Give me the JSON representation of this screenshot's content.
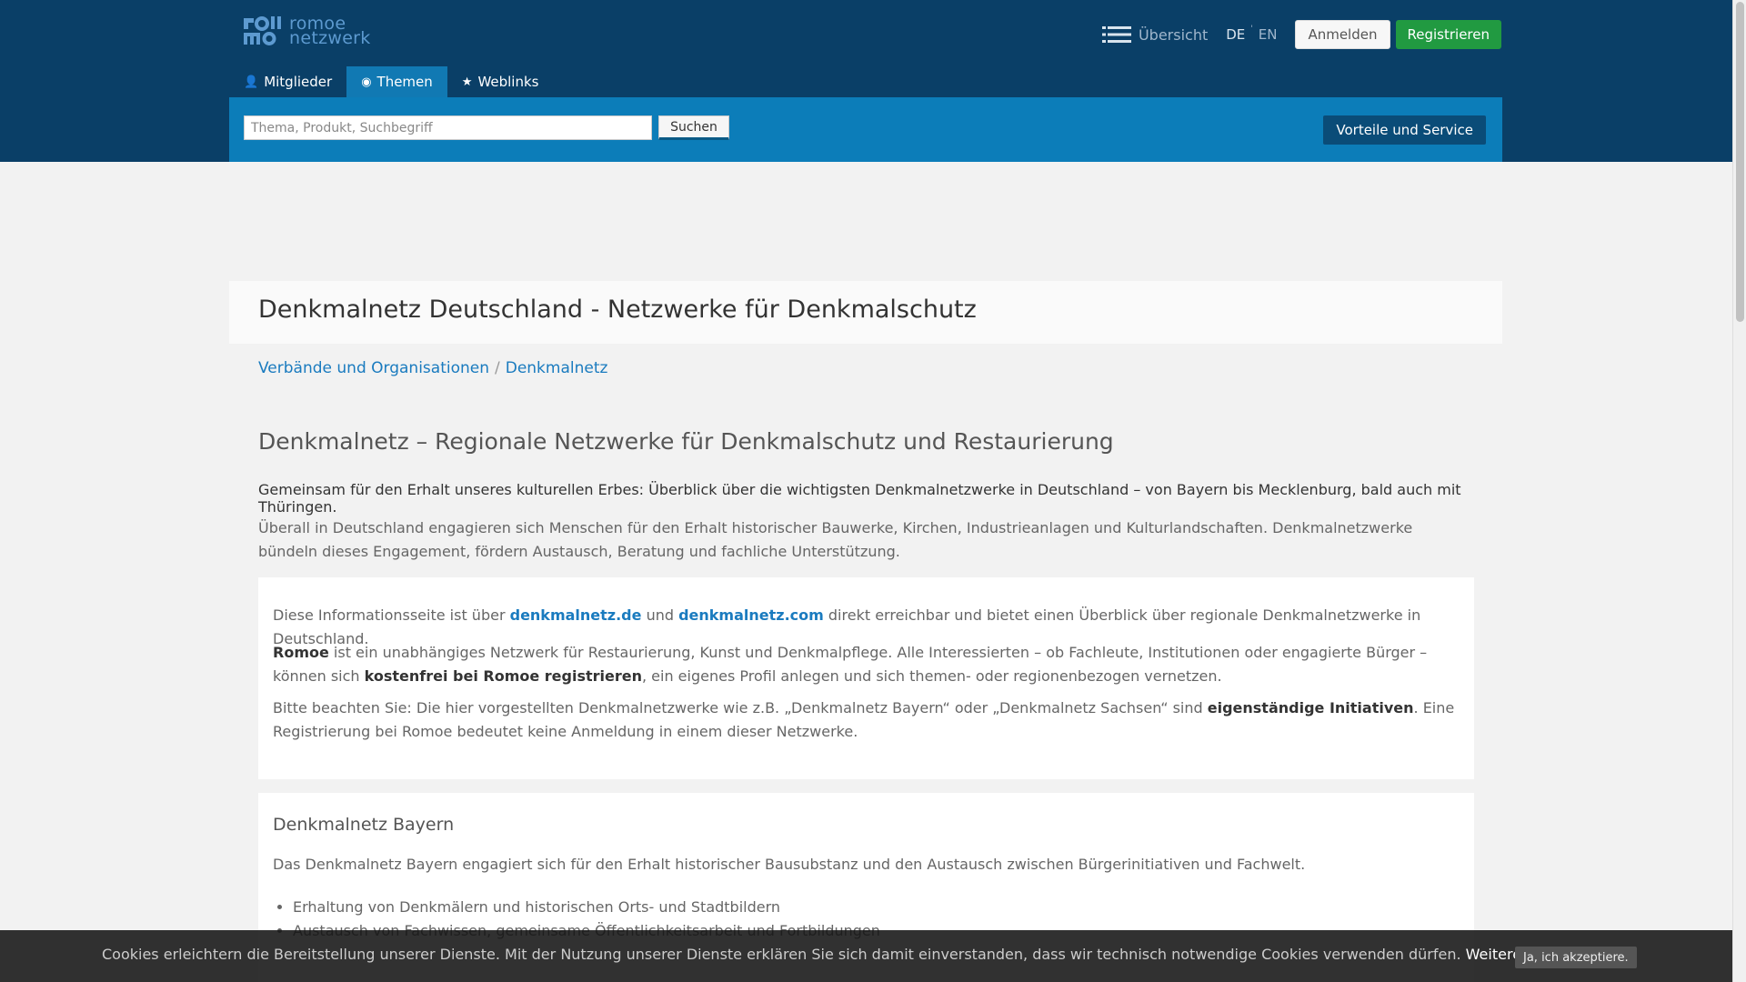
{
  "brand": {
    "logo_mark": "rom\nmo",
    "logo_text_1": "romoe",
    "logo_text_2": "netzwerk"
  },
  "header": {
    "overview_label": "Übersicht",
    "lang_de": "DE",
    "lang_sep": "'",
    "lang_en": "EN",
    "login_label": "Anmelden",
    "register_label": "Registrieren"
  },
  "tabs": [
    {
      "label": "Mitglieder",
      "icon": "person-icon",
      "glyph": "👤"
    },
    {
      "label": "Themen",
      "icon": "globe-icon",
      "glyph": "◉"
    },
    {
      "label": "Weblinks",
      "icon": "star-icon",
      "glyph": "★"
    }
  ],
  "search": {
    "placeholder": "Thema, Produkt, Suchbegriff",
    "button_label": "Suchen",
    "service_label": "Vorteile und Service"
  },
  "page": {
    "title": "Denkmalnetz Deutschland - Netzwerke für Denkmalschutz",
    "breadcrumb": [
      "Verbände und Organisationen",
      "Denkmalnetz"
    ],
    "breadcrumb_sep": "/",
    "heading": "Denkmalnetz – Regionale Netzwerke für Denkmalschutz und Restaurierung",
    "lead": "Gemeinsam für den Erhalt unseres kulturellen Erbes: Überblick über die wichtigsten Denkmalnetzwerke in Deutschland – von Bayern bis Mecklenburg, bald auch mit Thüringen.",
    "intro": "Überall in Deutschland engagieren sich Menschen für den Erhalt historischer Bauwerke, Kirchen, Industrieanlagen und Kulturlandschaften. Denkmalnetzwerke bündeln dieses Engagement, fördern Austausch, Beratung und fachliche Unterstützung."
  },
  "info_card": {
    "p1_a": "Diese Informationsseite ist über ",
    "p1_link1": "denkmalnetz.de",
    "p1_b": " und ",
    "p1_link2": "denkmalnetz.com",
    "p1_c": " direkt erreichbar und bietet einen Überblick über regionale Denkmalnetzwerke in Deutschland.",
    "p2_strong1": "Romoe",
    "p2_a": " ist ein unabhängiges Netzwerk für Restaurierung, Kunst und Denkmalpflege. Alle Interessierten – ob Fachleute, Institutionen oder engagierte Bürger – können sich ",
    "p2_strong2": "kostenfrei bei Romoe registrieren",
    "p2_b": ", ein eigenes Profil anlegen und sich themen- oder regionenbezogen vernetzen.",
    "p3_a": "Bitte beachten Sie: Die hier vorgestellten Denkmalnetzwerke wie z.B. „Denkmalnetz Bayern“ oder „Denkmalnetz Sachsen“ sind ",
    "p3_strong": "eigenständige Initiativen",
    "p3_b": ". Eine Registrierung bei Romoe bedeutet keine Anmeldung in einem dieser Netzwerke."
  },
  "bayern_card": {
    "heading": "Denkmalnetz Bayern",
    "description": "Das Denkmalnetz Bayern engagiert sich für den Erhalt historischer Bausubstanz und den Austausch zwischen Bürgerinitiativen und Fachwelt.",
    "items": [
      "Erhaltung von Denkmälern und historischen Orts- und Stadtbildern",
      "Austausch von Fachwissen, gemeinsame Öffentlichkeitsarbeit und Fortbildungen"
    ]
  },
  "cookie": {
    "text": "Cookies erleichtern die Bereitstellung unserer Dienste. Mit der Nutzung unserer Dienste erklären Sie sich damit einverstanden, dass wir technisch notwendige Cookies verwenden dürfen.",
    "link": "Weitere Informationen",
    "accept": "Ja, ich akzeptiere."
  },
  "colors": {
    "header_bg": "#0a3f67",
    "search_bar_bg": "#0c7db9",
    "register_green": "#219a41",
    "link_blue": "#1a7bbf"
  }
}
